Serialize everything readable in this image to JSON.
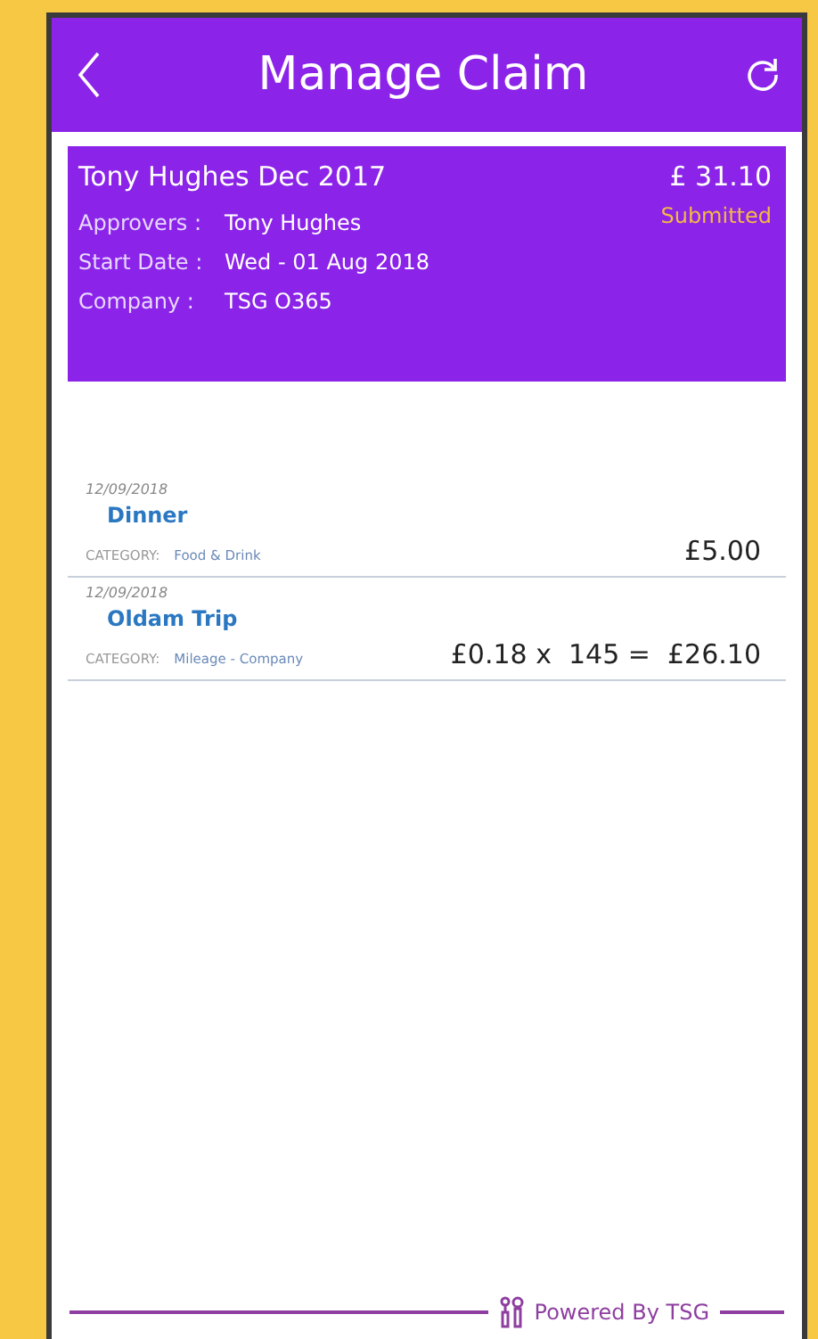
{
  "header": {
    "title": "Manage Claim"
  },
  "claim": {
    "name": "Tony Hughes Dec 2017",
    "amount": "£ 31.10",
    "status": "Submitted",
    "fields": [
      {
        "label": "Approvers :",
        "value": "Tony Hughes"
      },
      {
        "label": "Start Date :",
        "value": "Wed - 01 Aug 2018"
      },
      {
        "label": "Company :",
        "value": "TSG O365"
      }
    ]
  },
  "expenses": [
    {
      "date": "12/09/2018",
      "title": "Dinner",
      "category_label": "CATEGORY:",
      "category": "Food & Drink",
      "amount": "£5.00"
    },
    {
      "date": "12/09/2018",
      "title": "Oldam Trip",
      "category_label": "CATEGORY:",
      "category": "Mileage - Company",
      "amount": "£0.18 x  145 =  £26.10"
    }
  ],
  "footer": {
    "text": "Powered By TSG"
  }
}
